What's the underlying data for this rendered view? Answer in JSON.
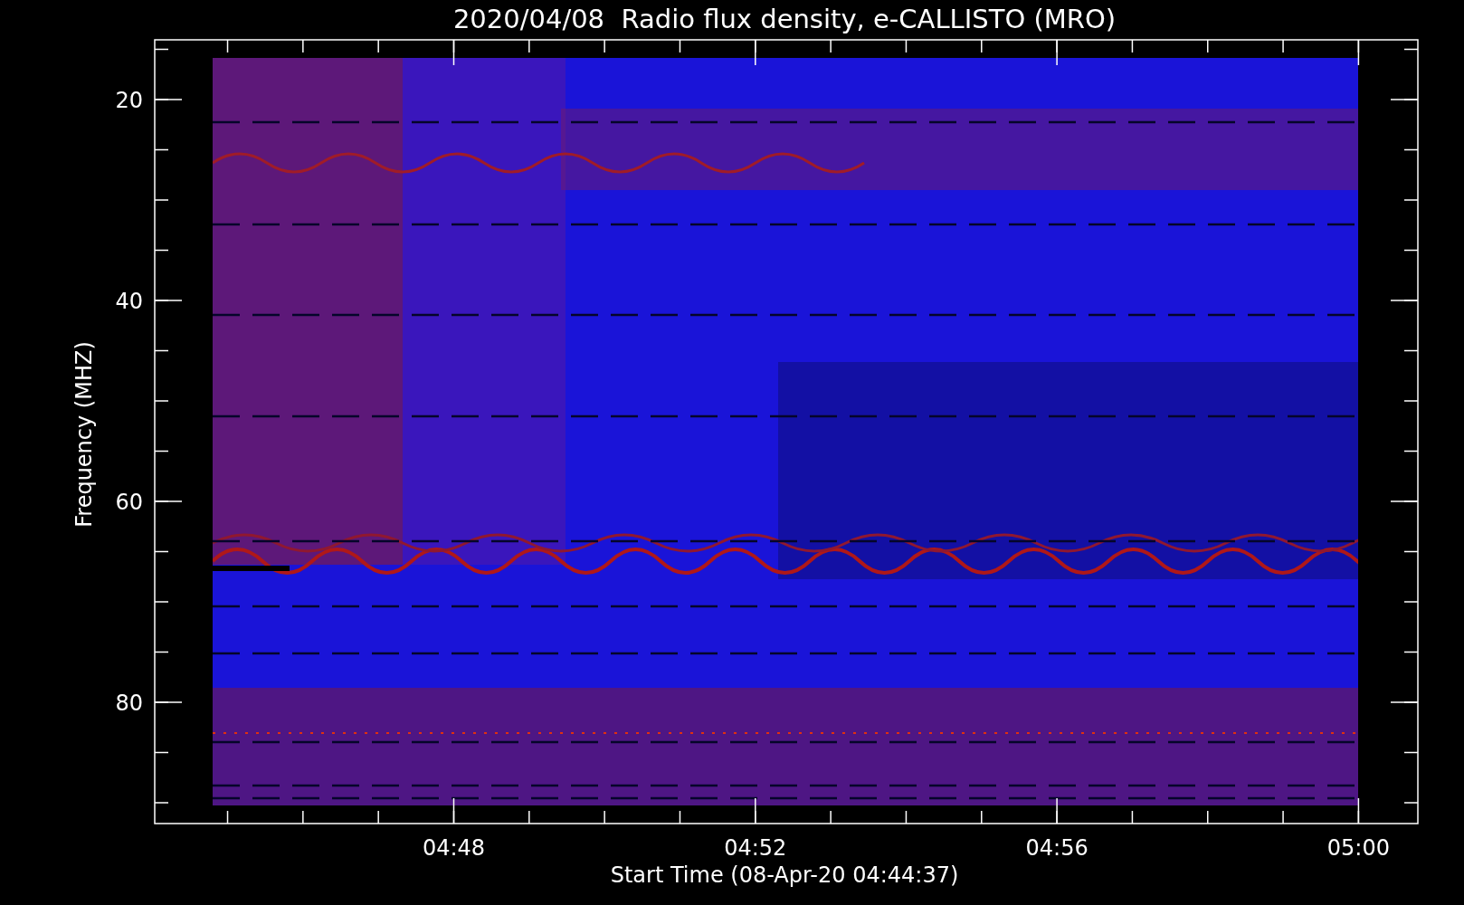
{
  "title": "2020/04/08  Radio flux density, e-CALLISTO (MRO)",
  "xlabel": "Start Time (08-Apr-20 04:44:37)",
  "ylabel": "Frequency (MHZ)",
  "xticks": [
    "04:48",
    "04:52",
    "04:56",
    "05:00"
  ],
  "yticks": [
    "20",
    "40",
    "60",
    "80"
  ]
}
